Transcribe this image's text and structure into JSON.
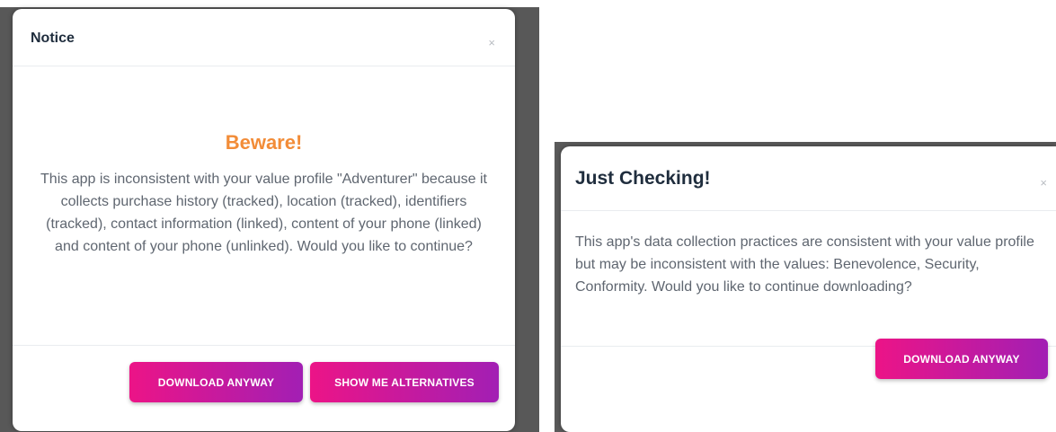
{
  "notice_dialog": {
    "title": "Notice",
    "close_glyph": "×",
    "heading": "Beware!",
    "message": "This app is inconsistent with your value profile \"Adventurer\" because it collects purchase history (tracked), location (tracked), identifiers (tracked), contact information (linked), content of your phone (linked) and content of your phone (unlinked). Would you like to continue?",
    "download_label": "DOWNLOAD ANYWAY",
    "alternatives_label": "SHOW ME ALTERNATIVES"
  },
  "checking_dialog": {
    "title": "Just Checking!",
    "close_glyph": "×",
    "message": "This app's data collection practices are consistent with your value profile but may be inconsistent with the values: Benevolence, Security, Conformity. Would you like to continue downloading?",
    "download_label": "DOWNLOAD ANYWAY"
  },
  "colors": {
    "heading_accent": "#f28c38",
    "button_gradient_start": "#ec1487",
    "button_gradient_end": "#a21fb4",
    "title_text": "#1f2d3d",
    "body_text": "#5f6670"
  },
  "icons": {
    "close": "close-icon"
  }
}
